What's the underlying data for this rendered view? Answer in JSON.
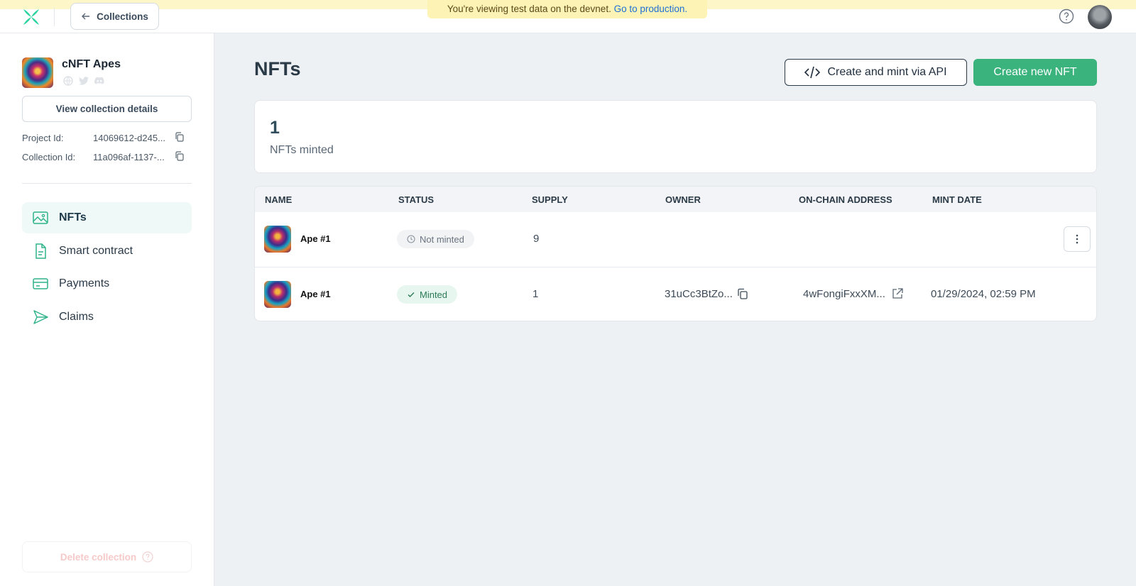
{
  "banner": {
    "text": "You're viewing test data on the devnet.",
    "link": "Go to production."
  },
  "header": {
    "back_label": "Collections"
  },
  "collection": {
    "name": "cNFT Apes",
    "view_details_label": "View collection details",
    "project_id_label": "Project Id:",
    "project_id_value": "14069612-d245...",
    "collection_id_label": "Collection Id:",
    "collection_id_value": "11a096af-1137-..."
  },
  "sidebar": {
    "items": [
      {
        "label": "NFTs",
        "icon": "image-icon",
        "active": true
      },
      {
        "label": "Smart contract",
        "icon": "document-icon",
        "active": false
      },
      {
        "label": "Payments",
        "icon": "credit-card-icon",
        "active": false
      },
      {
        "label": "Claims",
        "icon": "send-icon",
        "active": false
      }
    ],
    "delete_label": "Delete collection"
  },
  "main": {
    "title": "NFTs",
    "api_button": "Create and mint via API",
    "new_button": "Create new NFT",
    "stat": {
      "value": "1",
      "label": "NFTs minted"
    }
  },
  "table": {
    "columns": [
      "NAME",
      "STATUS",
      "SUPPLY",
      "OWNER",
      "ON-CHAIN ADDRESS",
      "MINT DATE"
    ],
    "rows": [
      {
        "name": "Ape #1",
        "status": "Not minted",
        "supply": "9",
        "owner": "",
        "address": "",
        "mint_date": ""
      },
      {
        "name": "Ape #1",
        "status": "Minted",
        "supply": "1",
        "owner": "31uCc3BtZo...",
        "address": "4wFongiFxxXM...",
        "mint_date": "01/29/2024, 02:59 PM"
      }
    ]
  },
  "colors": {
    "accent": "#3ab37d",
    "banner": "#fdf3b4",
    "link": "#1f6fd6"
  }
}
